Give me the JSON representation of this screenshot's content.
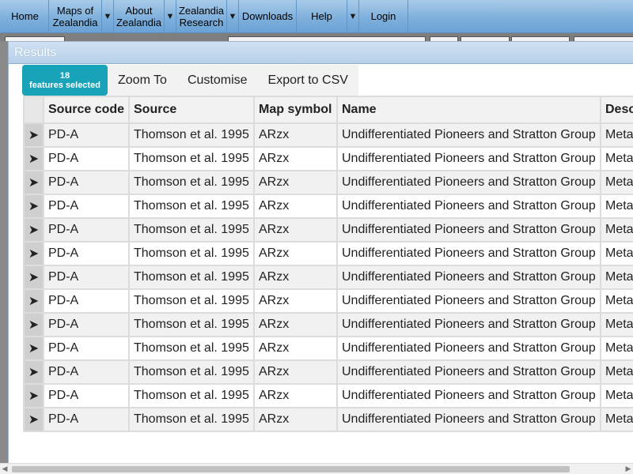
{
  "nav": {
    "items": [
      {
        "label": "Home",
        "has_caret": false
      },
      {
        "label": "Maps of Zealandia",
        "has_caret": true
      },
      {
        "label": "About Zealandia",
        "has_caret": true
      },
      {
        "label": "Zealandia Research",
        "has_caret": true
      },
      {
        "label": "Downloads",
        "has_caret": false
      },
      {
        "label": "Help",
        "has_caret": true
      },
      {
        "label": "Login",
        "has_caret": false
      }
    ],
    "caret_glyph": "▼"
  },
  "panel": {
    "title": "Results"
  },
  "toolbar": {
    "selected_count": "18",
    "selected_label": "features selected",
    "zoom_to_label": "Zoom To",
    "customise_label": "Customise",
    "export_label": "Export to CSV"
  },
  "table": {
    "row_icon": "➤",
    "columns": [
      "Source code",
      "Source",
      "Map symbol",
      "Name",
      "Desc"
    ],
    "rows": [
      [
        "PD-A",
        "Thomson et al. 1995",
        "ARzx",
        "Undifferentiated Pioneers and Stratton Group",
        "Meta"
      ],
      [
        "PD-A",
        "Thomson et al. 1995",
        "ARzx",
        "Undifferentiated Pioneers and Stratton Group",
        "Meta"
      ],
      [
        "PD-A",
        "Thomson et al. 1995",
        "ARzx",
        "Undifferentiated Pioneers and Stratton Group",
        "Meta"
      ],
      [
        "PD-A",
        "Thomson et al. 1995",
        "ARzx",
        "Undifferentiated Pioneers and Stratton Group",
        "Meta"
      ],
      [
        "PD-A",
        "Thomson et al. 1995",
        "ARzx",
        "Undifferentiated Pioneers and Stratton Group",
        "Meta"
      ],
      [
        "PD-A",
        "Thomson et al. 1995",
        "ARzx",
        "Undifferentiated Pioneers and Stratton Group",
        "Meta"
      ],
      [
        "PD-A",
        "Thomson et al. 1995",
        "ARzx",
        "Undifferentiated Pioneers and Stratton Group",
        "Meta"
      ],
      [
        "PD-A",
        "Thomson et al. 1995",
        "ARzx",
        "Undifferentiated Pioneers and Stratton Group",
        "Meta"
      ],
      [
        "PD-A",
        "Thomson et al. 1995",
        "ARzx",
        "Undifferentiated Pioneers and Stratton Group",
        "Meta"
      ],
      [
        "PD-A",
        "Thomson et al. 1995",
        "ARzx",
        "Undifferentiated Pioneers and Stratton Group",
        "Meta"
      ],
      [
        "PD-A",
        "Thomson et al. 1995",
        "ARzx",
        "Undifferentiated Pioneers and Stratton Group",
        "Meta"
      ],
      [
        "PD-A",
        "Thomson et al. 1995",
        "ARzx",
        "Undifferentiated Pioneers and Stratton Group",
        "Meta"
      ],
      [
        "PD-A",
        "Thomson et al. 1995",
        "ARzx",
        "Undifferentiated Pioneers and Stratton Group",
        "Meta"
      ]
    ]
  },
  "colors": {
    "badge": "#19a3b8",
    "nav_gradient_top": "#a9cbe9",
    "nav_gradient_bottom": "#6aa2d5"
  }
}
